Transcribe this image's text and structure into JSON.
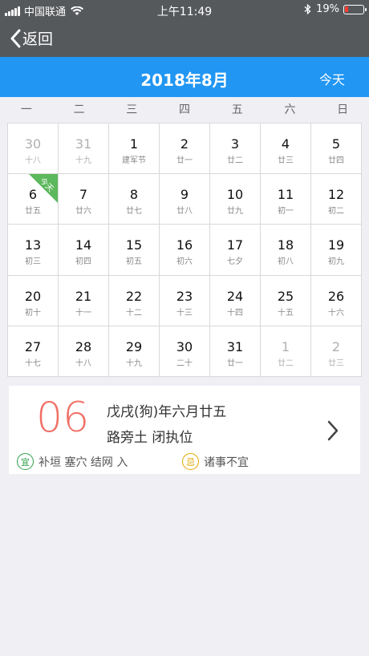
{
  "status": {
    "carrier": "中国联通",
    "time": "上午11:49",
    "battery": "19%",
    "battery_level": 0.19,
    "icons": [
      "signal-icon",
      "wifi-icon",
      "bluetooth-icon",
      "battery-icon"
    ]
  },
  "nav": {
    "back_label": "返回"
  },
  "month": {
    "title": "2018年8月",
    "today_label": "今天"
  },
  "colors": {
    "nav_bg": "#56595c",
    "accent": "#2196f3",
    "today_marker": "#5cb85c",
    "big_day": "#f07167",
    "yi": "#2e9f4b",
    "ji": "#e0a800"
  },
  "weekdays": [
    "一",
    "二",
    "三",
    "四",
    "五",
    "六",
    "日"
  ],
  "weeks": [
    [
      {
        "d": "30",
        "l": "十八",
        "o": true
      },
      {
        "d": "31",
        "l": "十九",
        "o": true
      },
      {
        "d": "1",
        "l": "建军节"
      },
      {
        "d": "2",
        "l": "廿一"
      },
      {
        "d": "3",
        "l": "廿二"
      },
      {
        "d": "4",
        "l": "廿三"
      },
      {
        "d": "5",
        "l": "廿四"
      }
    ],
    [
      {
        "d": "6",
        "l": "廿五",
        "t": true
      },
      {
        "d": "7",
        "l": "廿六"
      },
      {
        "d": "8",
        "l": "廿七"
      },
      {
        "d": "9",
        "l": "廿八"
      },
      {
        "d": "10",
        "l": "廿九"
      },
      {
        "d": "11",
        "l": "初一"
      },
      {
        "d": "12",
        "l": "初二"
      }
    ],
    [
      {
        "d": "13",
        "l": "初三"
      },
      {
        "d": "14",
        "l": "初四"
      },
      {
        "d": "15",
        "l": "初五"
      },
      {
        "d": "16",
        "l": "初六"
      },
      {
        "d": "17",
        "l": "七夕"
      },
      {
        "d": "18",
        "l": "初八"
      },
      {
        "d": "19",
        "l": "初九"
      }
    ],
    [
      {
        "d": "20",
        "l": "初十"
      },
      {
        "d": "21",
        "l": "十一"
      },
      {
        "d": "22",
        "l": "十二"
      },
      {
        "d": "23",
        "l": "十三"
      },
      {
        "d": "24",
        "l": "十四"
      },
      {
        "d": "25",
        "l": "十五"
      },
      {
        "d": "26",
        "l": "十六"
      }
    ],
    [
      {
        "d": "27",
        "l": "十七"
      },
      {
        "d": "28",
        "l": "十八"
      },
      {
        "d": "29",
        "l": "十九"
      },
      {
        "d": "30",
        "l": "二十"
      },
      {
        "d": "31",
        "l": "廿一"
      },
      {
        "d": "1",
        "l": "廿二",
        "o": true
      },
      {
        "d": "2",
        "l": "廿三",
        "o": true
      }
    ]
  ],
  "today_marker_label": "今天",
  "detail": {
    "big_day": "06",
    "lunar_date": "戊戌(狗)年六月廿五",
    "ganzhi": "路旁土 闭执位",
    "yi_badge": "宜",
    "yi_text": "补垣 塞穴 结网 入",
    "ji_badge": "忌",
    "ji_text": "诸事不宜"
  }
}
